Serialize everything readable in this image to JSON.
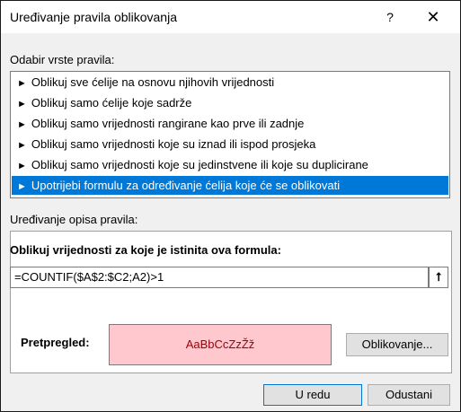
{
  "window": {
    "title": "Uređivanje pravila oblikovanja",
    "help_icon": "?",
    "close_icon": "✕"
  },
  "rule_type": {
    "label": "Odabir vrste pravila:",
    "arrow_icon": "►",
    "items": [
      {
        "label": "Oblikuj sve ćelije na osnovu njihovih vrijednosti",
        "selected": false
      },
      {
        "label": "Oblikuj samo ćelije koje sadrže",
        "selected": false
      },
      {
        "label": "Oblikuj samo vrijednosti rangirane kao prve ili zadnje",
        "selected": false
      },
      {
        "label": "Oblikuj samo vrijednosti koje su iznad ili ispod prosjeka",
        "selected": false
      },
      {
        "label": "Oblikuj samo vrijednosti koje su jedinstvene ili koje su duplicirane",
        "selected": false
      },
      {
        "label": "Upotrijebi formulu za određivanje ćelija koje će se oblikovati",
        "selected": true
      }
    ]
  },
  "rule_edit": {
    "label": "Uređivanje opisa pravila:",
    "formula_label": "Oblikuj vrijednosti za koje je istinita ova formula:",
    "formula_value": "=COUNTIF($A$2:$C2;A2)>1",
    "collapse_icon": "⭡",
    "preview_label": "Pretpregled:",
    "preview_text": "AaBbCcZzŽž",
    "format_button": "Oblikovanje..."
  },
  "buttons": {
    "ok": "U redu",
    "cancel": "Odustani"
  },
  "colors": {
    "selection": "#0078d7",
    "preview_fill": "#ffc7ce",
    "preview_text": "#9c0006"
  }
}
